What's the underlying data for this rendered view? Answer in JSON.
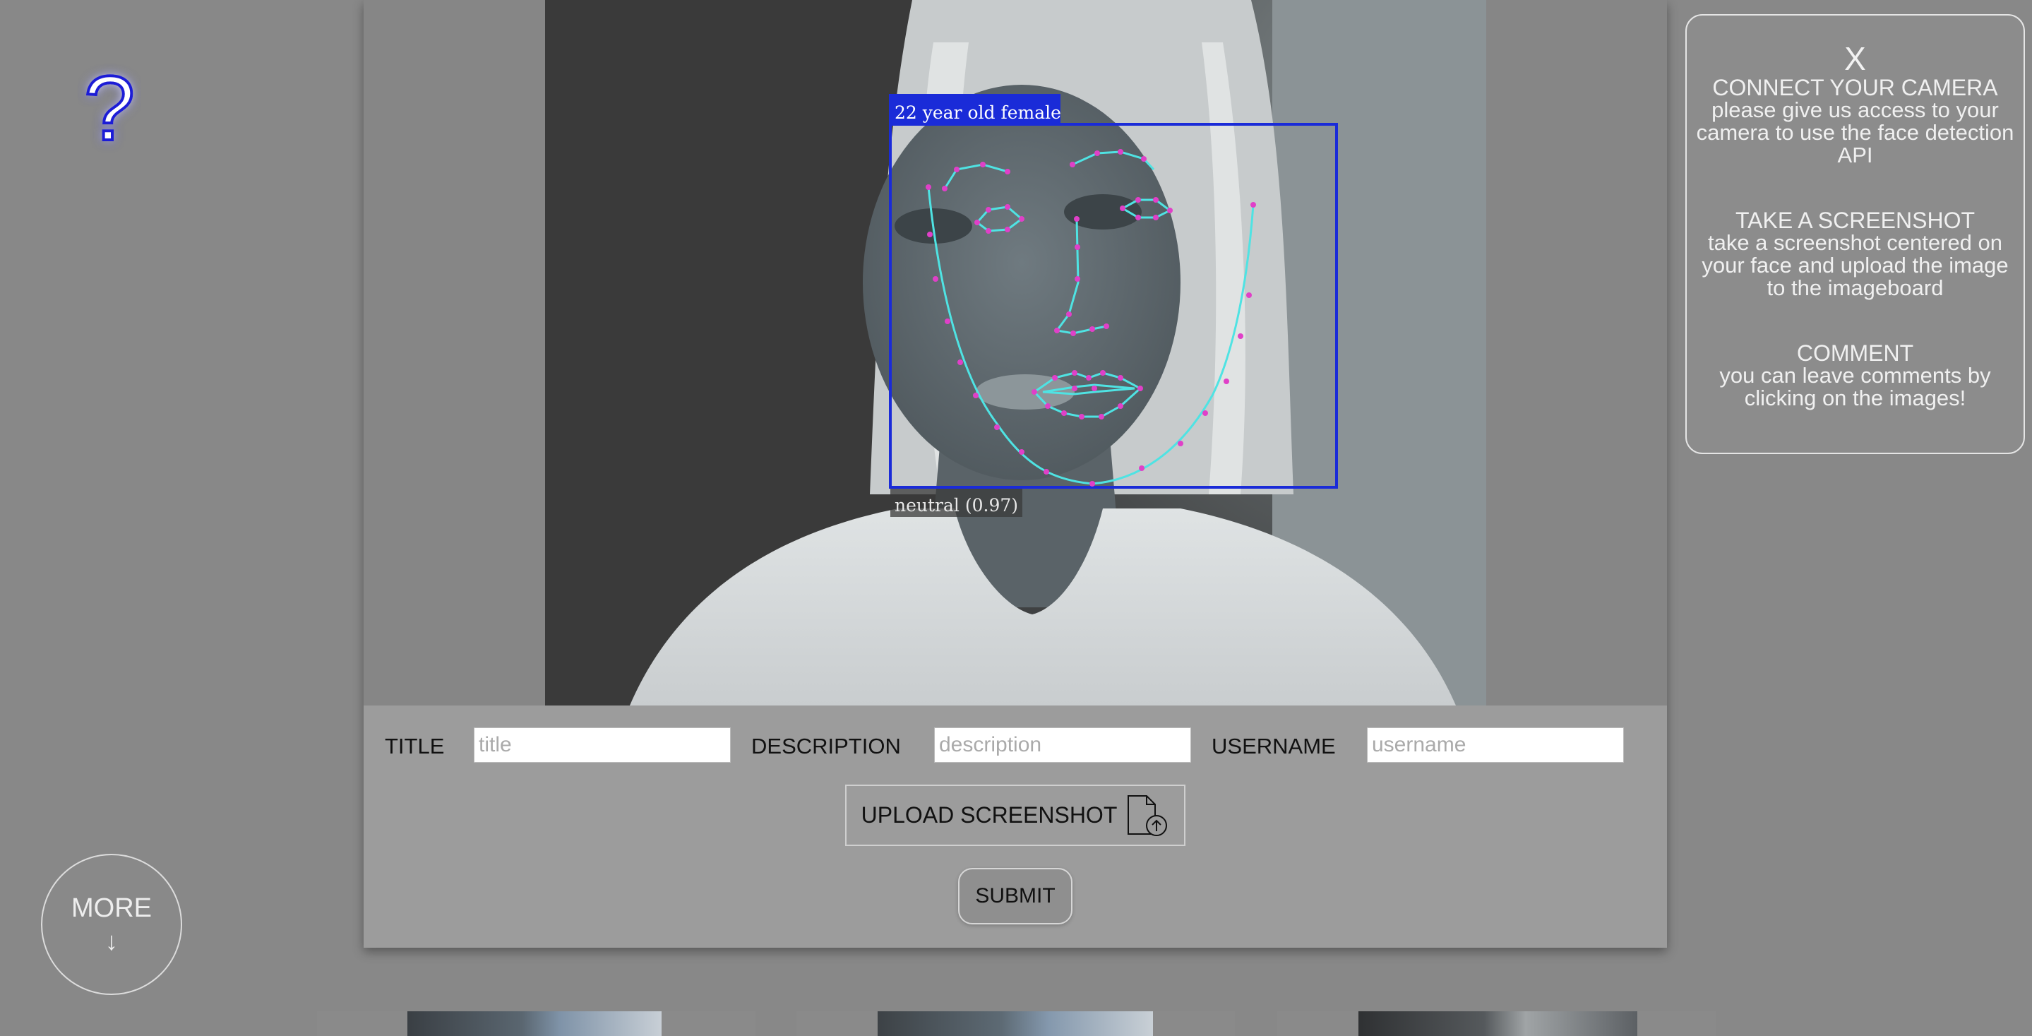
{
  "detection": {
    "age_label": "22 year old female",
    "expression_label": "neutral (0.97)"
  },
  "form": {
    "title_label": "TITLE",
    "title_placeholder": "title",
    "description_label": "DESCRIPTION",
    "description_placeholder": "description",
    "username_label": "USERNAME",
    "username_placeholder": "username",
    "upload_label": "UPLOAD SCREENSHOT",
    "upload_icon": "file-upload-icon",
    "submit_label": "SUBMIT"
  },
  "help": {
    "icon": "question-mark-icon",
    "glyph": "?"
  },
  "info_panel": {
    "close_label": "X",
    "sections": [
      {
        "title": "CONNECT YOUR CAMERA",
        "body": "please give us access to your camera to use the face detection API"
      },
      {
        "title": "TAKE A SCREENSHOT",
        "body": "take a screenshot centered on your face and upload the image to the imageboard"
      },
      {
        "title": "COMMENT",
        "body": "you can leave comments by clicking on the images!"
      }
    ]
  },
  "more_button": {
    "label": "MORE",
    "arrow": "↓"
  },
  "colors": {
    "detection_box": "#1a2bd8",
    "landmark_lines": "#4fe3e3",
    "landmark_points": "#e040c8",
    "help_icon": "#1a1ad6"
  }
}
